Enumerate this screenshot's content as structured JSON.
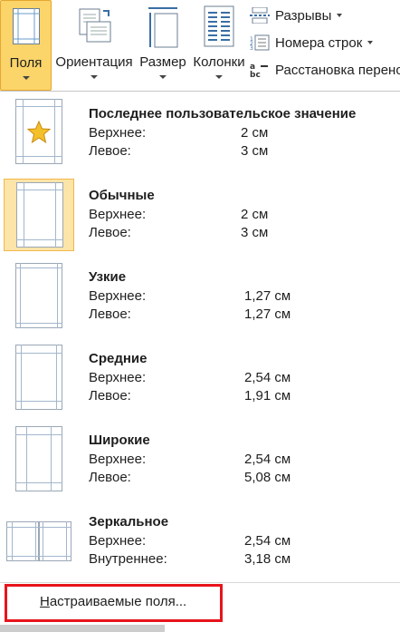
{
  "ribbon": {
    "buttons": [
      {
        "id": "margins",
        "label": "Поля",
        "icon": "margins-icon",
        "active": true
      },
      {
        "id": "orientation",
        "label": "Ориентация",
        "icon": "orientation-icon"
      },
      {
        "id": "size",
        "label": "Размер",
        "icon": "size-icon"
      },
      {
        "id": "columns",
        "label": "Колонки",
        "icon": "columns-icon"
      }
    ],
    "small": [
      {
        "label": "Разрывы",
        "icon": "breaks-icon",
        "dropdown": true
      },
      {
        "label": "Номера строк",
        "icon": "line-numbers-icon",
        "dropdown": true
      },
      {
        "label": "Расстановка перено",
        "icon": "hyphenation-icon",
        "dropdown": false
      }
    ]
  },
  "menu": {
    "items": [
      {
        "name": "Последнее пользовательское значение",
        "l1": "Верхнее:",
        "v1": "2 см",
        "l2": "Левое:",
        "v2": "3 см",
        "icon": "star-icon"
      },
      {
        "name": "Обычные",
        "l1": "Верхнее:",
        "v1": "2 см",
        "l2": "Левое:",
        "v2": "3 см",
        "selected": true
      },
      {
        "name": "Узкие",
        "l1": "Верхнее:",
        "v1": "1,27 см",
        "l2": "Левое:",
        "v2": "1,27 см"
      },
      {
        "name": "Средние",
        "l1": "Верхнее:",
        "v1": "2,54 см",
        "l2": "Левое:",
        "v2": "1,91 см"
      },
      {
        "name": "Широкие",
        "l1": "Верхнее:",
        "v1": "2,54 см",
        "l2": "Левое:",
        "v2": "5,08 см"
      },
      {
        "name": "Зеркальное",
        "l1": "Верхнее:",
        "v1": "2,54 см",
        "l2": "Внутреннее:",
        "v2": "3,18 см"
      }
    ],
    "custom": {
      "prefix": "Н",
      "rest": "астраиваемые поля..."
    }
  },
  "colors": {
    "active_bg": "#fbd46a",
    "selected_bg": "#fde4a8",
    "highlight_border": "#e8141b",
    "margin_line": "#a3b7cc"
  }
}
